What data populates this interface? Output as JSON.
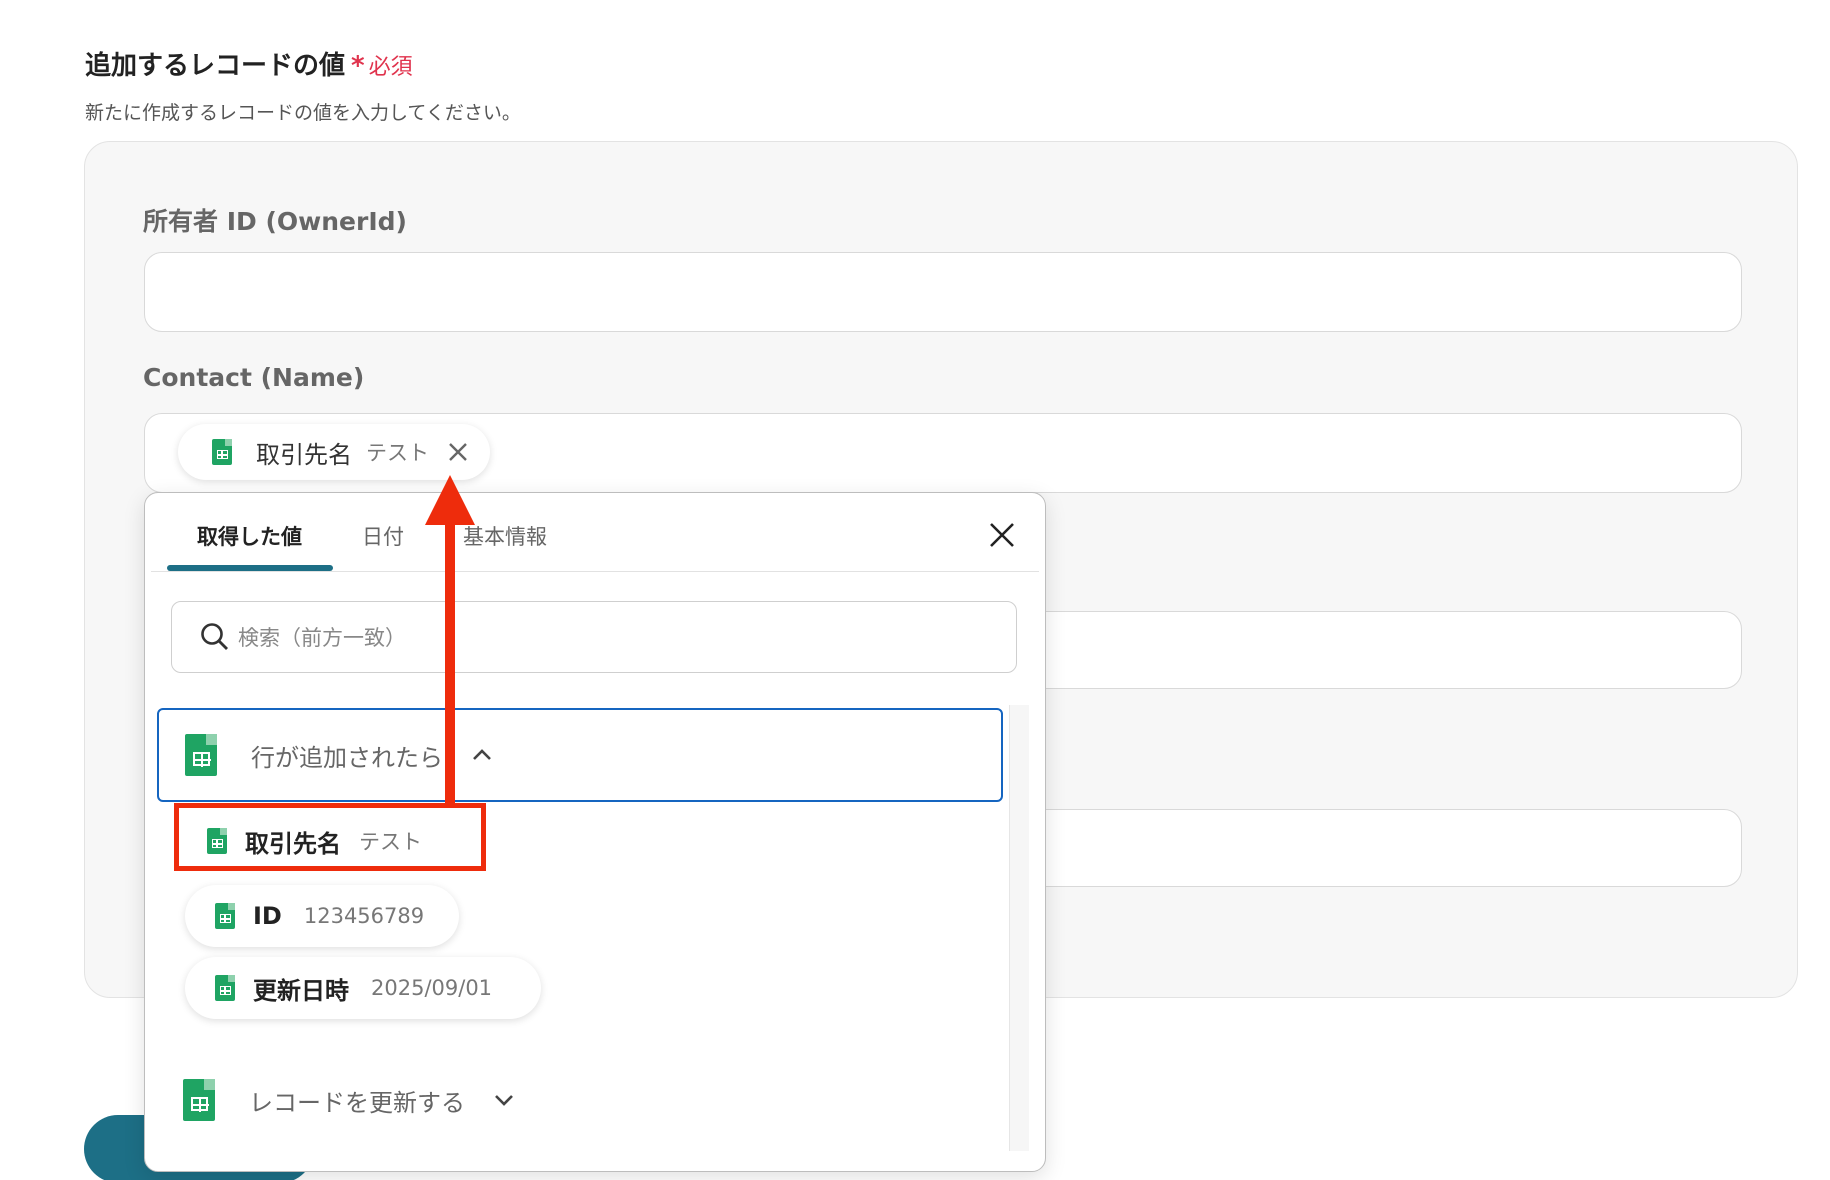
{
  "section": {
    "title": "追加するレコードの値",
    "required_star": "*",
    "required_text": "必須",
    "description": "新たに作成するレコードの値を入力してください。"
  },
  "fields": {
    "owner_label": "所有者 ID (OwnerId)",
    "owner_value": "",
    "contact_label": "Contact (Name)"
  },
  "contact_chip": {
    "key": "取引先名",
    "value": "テスト"
  },
  "popup": {
    "tabs": [
      {
        "label": "取得した値",
        "active": true
      },
      {
        "label": "日付",
        "active": false
      },
      {
        "label": "基本情報",
        "active": false
      }
    ],
    "search_placeholder": "検索（前方一致）",
    "groups": [
      {
        "label": "行が追加されたら",
        "expanded": true,
        "items": [
          {
            "key": "取引先名",
            "value": "テスト"
          },
          {
            "key": "ID",
            "value": "123456789"
          },
          {
            "key": "更新日時",
            "value": "2025/09/01"
          }
        ]
      },
      {
        "label": "レコードを更新する",
        "expanded": false
      }
    ]
  },
  "colors": {
    "accent": "#1d6f86",
    "required": "#e0334d",
    "annotation_red": "#ee2c0c",
    "sheets_green": "#1fa463",
    "selected_border": "#1565c0"
  },
  "icons": [
    "google-sheets-icon",
    "close-icon",
    "search-icon",
    "chevron-up-icon",
    "chevron-down-icon"
  ]
}
